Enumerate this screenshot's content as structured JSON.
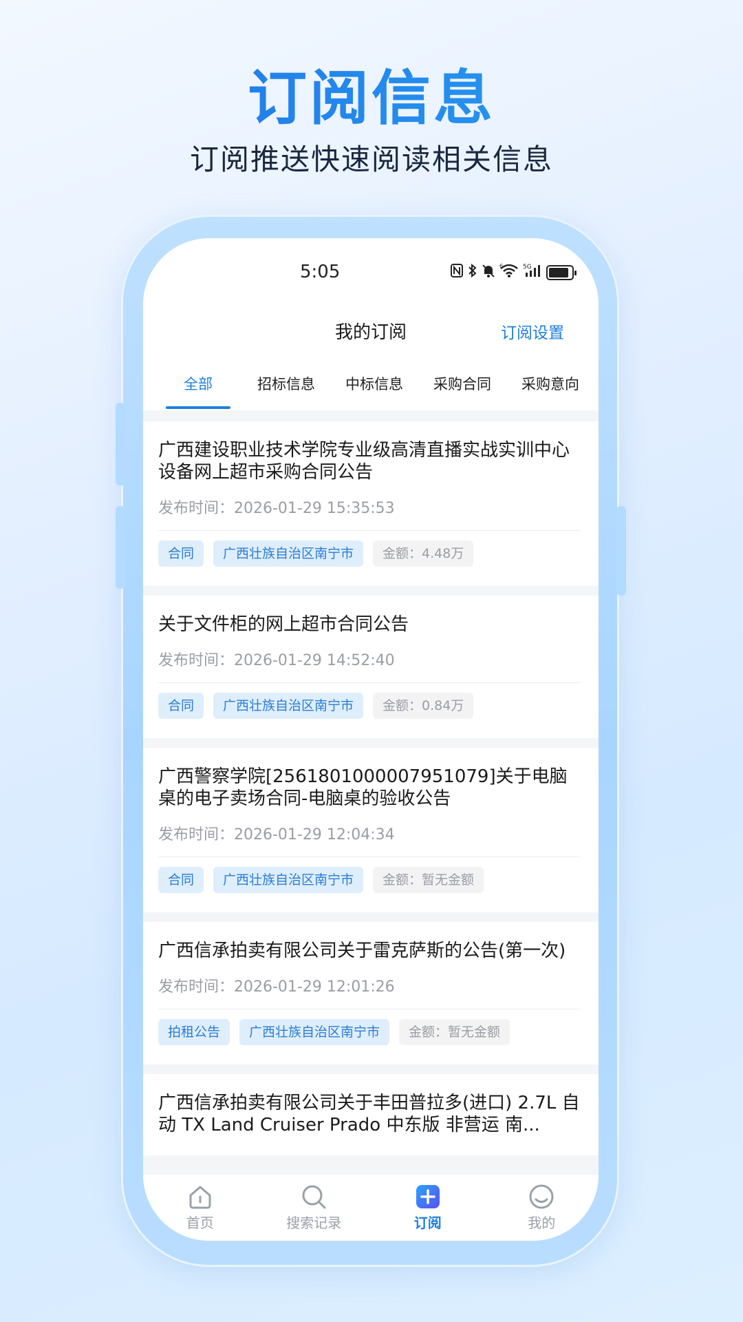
{
  "promo": {
    "title": "订阅信息",
    "subtitle": "订阅推送快速阅读相关信息"
  },
  "status_bar": {
    "time": "5:05",
    "icons": [
      "nfc-icon",
      "bluetooth-icon",
      "mute-icon",
      "wifi-icon",
      "5g-signal-icon",
      "battery-icon"
    ],
    "wifi_label": "6",
    "network_label": "5G"
  },
  "header": {
    "title": "我的订阅",
    "action": "订阅设置"
  },
  "tabs": [
    {
      "label": "全部",
      "active": true
    },
    {
      "label": "招标信息",
      "active": false
    },
    {
      "label": "中标信息",
      "active": false
    },
    {
      "label": "采购合同",
      "active": false
    },
    {
      "label": "采购意向",
      "active": false
    }
  ],
  "items": [
    {
      "title": "广西建设职业技术学院专业级高清直播实战实训中心设备网上超市采购合同公告",
      "time": "发布时间：2026-01-29 15:35:53",
      "type": "合同",
      "region": "广西壮族自治区南宁市",
      "amount": "金额：4.48万"
    },
    {
      "title": "关于文件柜的网上超市合同公告",
      "time": "发布时间：2026-01-29 14:52:40",
      "type": "合同",
      "region": "广西壮族自治区南宁市",
      "amount": "金额：0.84万"
    },
    {
      "title": "广西警察学院[2561801000007951079]关于电脑桌的电子卖场合同-电脑桌的验收公告",
      "time": "发布时间：2026-01-29 12:04:34",
      "type": "合同",
      "region": "广西壮族自治区南宁市",
      "amount": "金额：暂无金额"
    },
    {
      "title": "广西信承拍卖有限公司关于雷克萨斯的公告(第一次)",
      "time": "发布时间：2026-01-29 12:01:26",
      "type": "拍租公告",
      "region": "广西壮族自治区南宁市",
      "amount": "金额：暂无金额"
    },
    {
      "title": "广西信承拍卖有限公司关于丰田普拉多(进口) 2.7L 自动 TX Land Cruiser Prado 中东版 非营运 南...",
      "time": "",
      "type": "",
      "region": "",
      "amount": ""
    }
  ],
  "bottom_nav": [
    {
      "label": "首页",
      "icon": "home-icon",
      "active": false
    },
    {
      "label": "搜索记录",
      "icon": "search-icon",
      "active": false
    },
    {
      "label": "订阅",
      "icon": "add-subscribe-icon",
      "active": true
    },
    {
      "label": "我的",
      "icon": "profile-icon",
      "active": false
    }
  ],
  "colors": {
    "accent": "#1d7fe0",
    "title_gradient_start": "#1f6fe6",
    "title_gradient_end": "#28a3f2",
    "tag_bg": "#dfeefc",
    "muted": "#9a9da3"
  }
}
